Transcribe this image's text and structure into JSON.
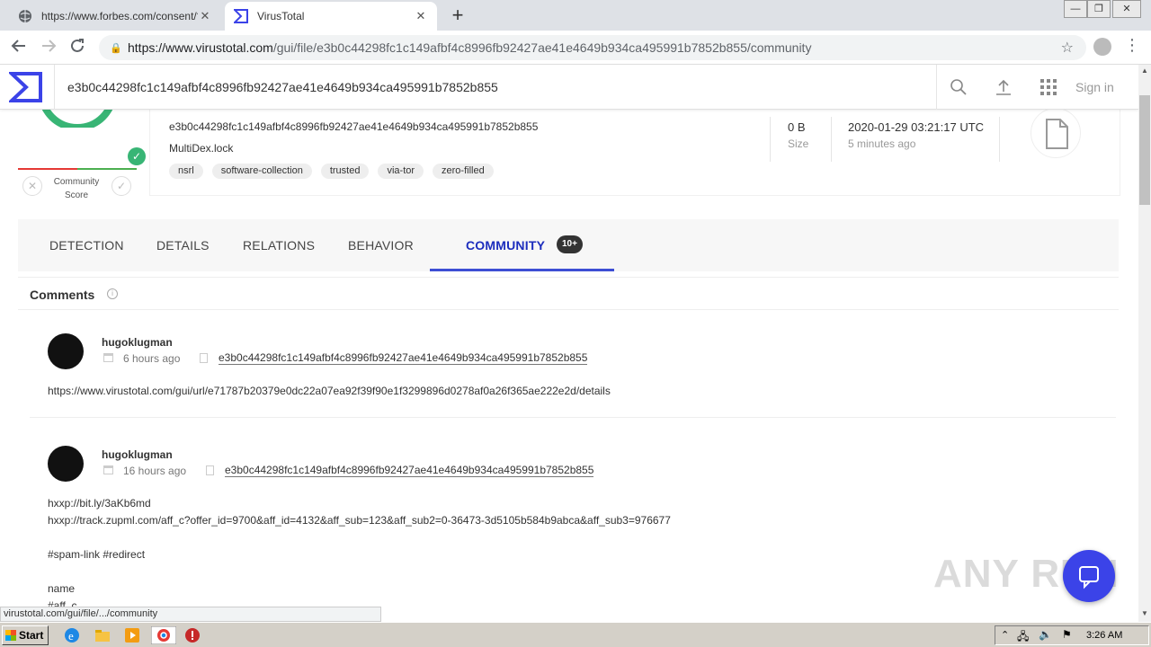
{
  "browser": {
    "tabs": [
      {
        "title": "https://www.forbes.com/consent/?t",
        "active": false
      },
      {
        "title": "VirusTotal",
        "active": true
      }
    ],
    "new_tab": "+",
    "url_host": "https://www.virustotal.com",
    "url_path": "/gui/file/e3b0c44298fc1c149afbf4c8996fb92427ae41e4649b934ca495991b7852b855/community",
    "status_url": "virustotal.com/gui/file/.../community"
  },
  "vt": {
    "search_value": "e3b0c44298fc1c149afbf4c8996fb92427ae41e4649b934ca495991b7852b855",
    "sign_in": "Sign in",
    "community_score_label": "Community Score",
    "file": {
      "hash": "e3b0c44298fc1c149afbf4c8996fb92427ae41e4649b934ca495991b7852b855",
      "name": "MultiDex.lock",
      "tags": [
        "nsrl",
        "software-collection",
        "trusted",
        "via-tor",
        "zero-filled"
      ],
      "size_value": "0 B",
      "size_label": "Size",
      "date": "2020-01-29 03:21:17 UTC",
      "date_ago": "5 minutes ago"
    },
    "tabs": [
      {
        "label": "DETECTION"
      },
      {
        "label": "DETAILS"
      },
      {
        "label": "RELATIONS"
      },
      {
        "label": "BEHAVIOR"
      },
      {
        "label": "COMMUNITY"
      }
    ],
    "community_badge": "10+",
    "comments_heading": "Comments",
    "comments": [
      {
        "user": "hugoklugman",
        "time": "6 hours ago",
        "target": "e3b0c44298fc1c149afbf4c8996fb92427ae41e4649b934ca495991b7852b855",
        "body": "https://www.virustotal.com/gui/url/e71787b20379e0dc22a07ea92f39f90e1f3299896d0278af0a26f365ae222e2d/details"
      },
      {
        "user": "hugoklugman",
        "time": "16 hours ago",
        "target": "e3b0c44298fc1c149afbf4c8996fb92427ae41e4649b934ca495991b7852b855",
        "body": "hxxp://bit.ly/3aKb6md\nhxxp://track.zupml.com/aff_c?offer_id=9700&aff_id=4132&aff_sub=123&aff_sub2=0-36473-3d5105b584b9abca&aff_sub3=976677\n\n#spam-link #redirect\n\nname\n#aff_c"
      }
    ]
  },
  "watermark": "ANY RUN",
  "taskbar": {
    "start": "Start",
    "clock": "3:26 AM"
  },
  "colors": {
    "accent": "#3d4ed4",
    "tab_active": "#1c2dbd",
    "score_green": "#38b575",
    "fab": "#3b43e8"
  }
}
